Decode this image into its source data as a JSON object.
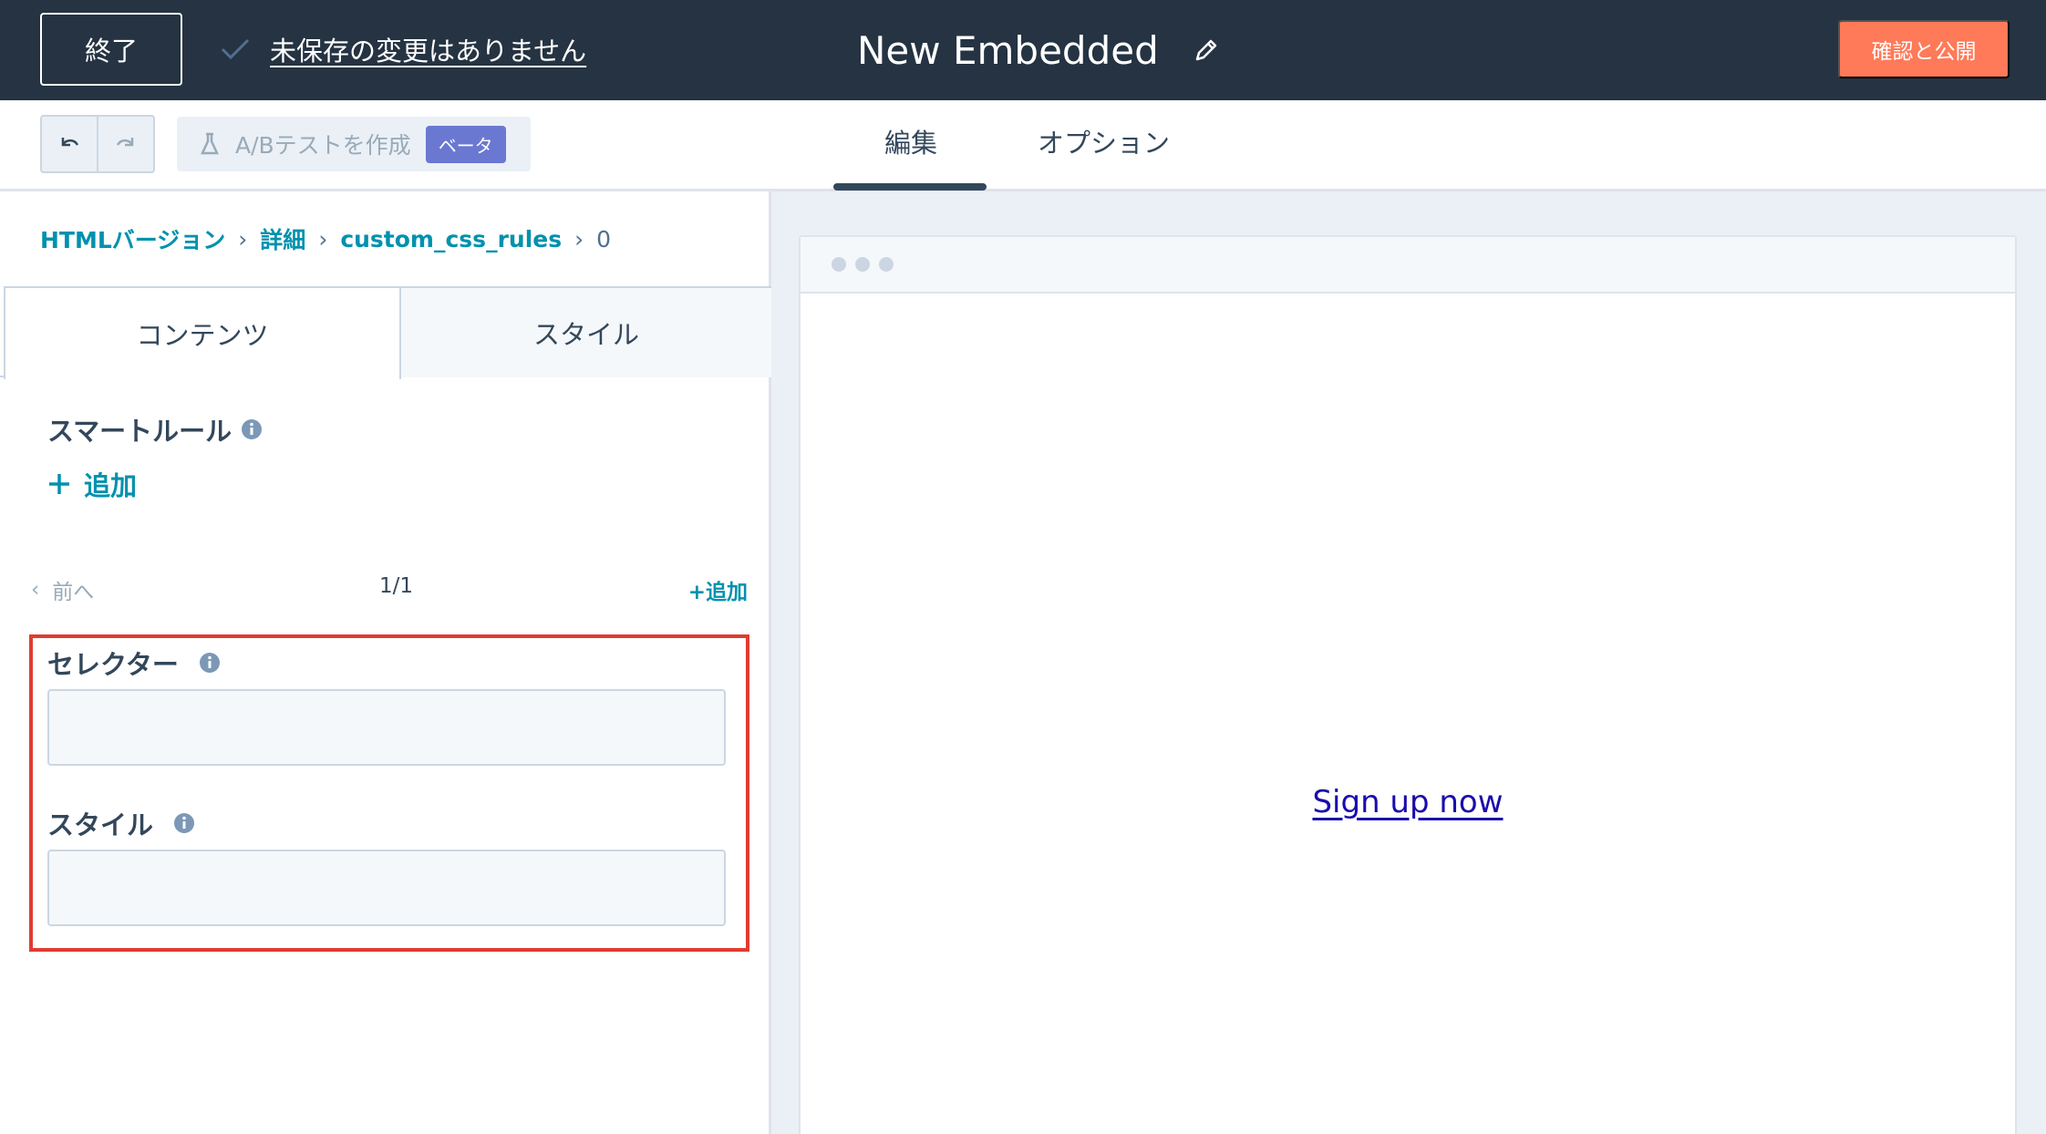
{
  "topbar": {
    "exit_label": "終了",
    "save_status": "未保存の変更はありません",
    "title": "New Embedded",
    "publish_label": "確認と公開"
  },
  "toolbar": {
    "ab_test_label": "A/Bテストを作成",
    "beta_badge": "ベータ",
    "tabs": [
      {
        "label": "編集",
        "active": true
      },
      {
        "label": "オプション",
        "active": false
      }
    ]
  },
  "breadcrumb": {
    "items": [
      "HTMLバージョン",
      "詳細",
      "custom_css_rules"
    ],
    "current": "0"
  },
  "sidebar": {
    "tabs": [
      {
        "label": "コンテンツ",
        "active": true
      },
      {
        "label": "スタイル",
        "active": false
      }
    ],
    "smart_rule_label": "スマートルール",
    "add_label": "追加",
    "pager": {
      "prev_label": "前へ",
      "count": "1/1",
      "add_label": "+追加"
    },
    "fields": {
      "selector_label": "セレクター",
      "selector_value": "",
      "style_label": "スタイル",
      "style_value": ""
    }
  },
  "preview": {
    "link_text": "Sign up now"
  },
  "colors": {
    "topbar_bg": "#253342",
    "publish_bg": "#ff7a59",
    "link": "#0091ae",
    "highlight": "#e03c31",
    "beta": "#6a78d1"
  }
}
